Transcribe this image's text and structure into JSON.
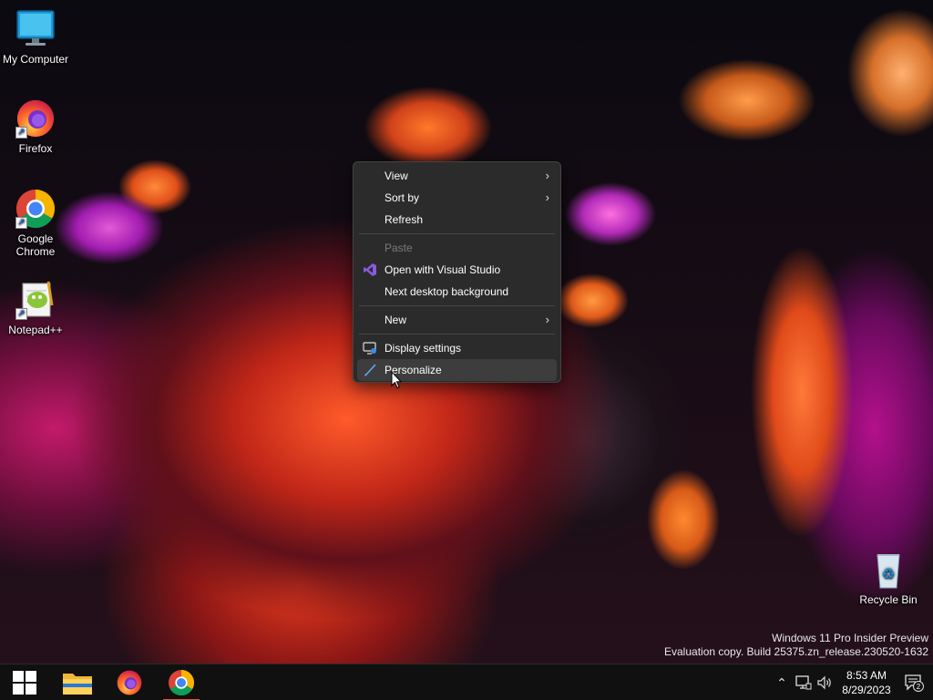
{
  "desktop": {
    "icons": [
      {
        "label": "My Computer"
      },
      {
        "label": "Firefox"
      },
      {
        "label": "Google Chrome"
      },
      {
        "label": "Notepad++"
      },
      {
        "label": "Recycle Bin"
      }
    ]
  },
  "context_menu": {
    "items": [
      {
        "label": "View",
        "has_submenu": true,
        "enabled": true
      },
      {
        "label": "Sort by",
        "has_submenu": true,
        "enabled": true
      },
      {
        "label": "Refresh",
        "enabled": true
      },
      {
        "label": "Paste",
        "enabled": false
      },
      {
        "label": "Open with Visual Studio",
        "icon": "visual-studio-icon",
        "enabled": true
      },
      {
        "label": "Next desktop background",
        "enabled": true
      },
      {
        "label": "New",
        "has_submenu": true,
        "enabled": true
      },
      {
        "label": "Display settings",
        "icon": "display-settings-icon",
        "enabled": true
      },
      {
        "label": "Personalize",
        "icon": "personalize-brush-icon",
        "enabled": true,
        "hovered": true
      }
    ]
  },
  "watermark": {
    "line1": "Windows 11 Pro Insider Preview",
    "line2": "Evaluation copy. Build 25375.zn_release.230520-1632"
  },
  "taskbar": {
    "pinned": [
      "start-button",
      "file-explorer",
      "firefox",
      "chrome"
    ],
    "active": "chrome",
    "clock": {
      "time": "8:53 AM",
      "date": "8/29/2023"
    },
    "notifications_count": "2"
  },
  "colors": {
    "menu_bg": "#2b2b2b",
    "menu_hover": "#3d3d3d",
    "taskbar_bg": "#101010",
    "start_blue": "#ffffff",
    "active_indicator": "#e05a3a"
  }
}
